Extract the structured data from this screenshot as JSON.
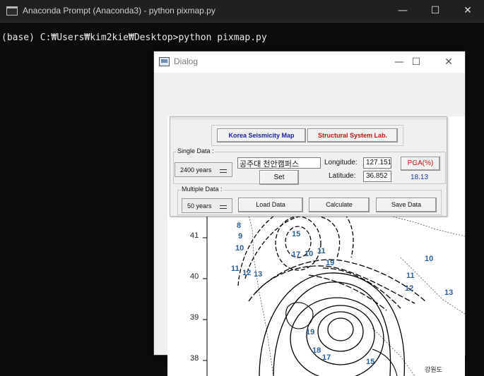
{
  "console": {
    "title": "Anaconda Prompt (Anaconda3) - python  pixmap.py",
    "command_line": "(base) C:₩Users₩kim2kie₩Desktop>python pixmap.py",
    "minimize_glyph": "—",
    "maximize_glyph": "☐",
    "close_glyph": "✕"
  },
  "dialog": {
    "title": "Dialog",
    "minimize_glyph": "—",
    "maximize_glyph": "☐",
    "close_glyph": "✕"
  },
  "panel": {
    "korea_map_button": "Korea Seismicity Map",
    "structural_lab_button": "Structural System Lab.",
    "single_data_label": "Single Data :",
    "years_select_value": "2400 years",
    "site_name_value": "공주대 천안캠퍼스",
    "set_button": "Set",
    "longitude_label": "Longitude:",
    "longitude_value": "127.151",
    "latitude_label": "Latitude:",
    "latitude_value": "36.852",
    "pga_button": "PGA(%)",
    "pga_value": "18.13",
    "multiple_data_label": "Multiple Data :",
    "multi_years_select_value": "50 years",
    "load_data_button": "Load Data",
    "calculate_button": "Calculate",
    "save_data_button": "Save Data",
    "korea_map_color": "#1a1aa8",
    "structural_lab_color": "#d01010",
    "pga_color": "#d01010",
    "pga_value_color": "#1a3aa8"
  },
  "map": {
    "lat_labels": [
      "41",
      "40",
      "39",
      "38"
    ],
    "contour_numbers": [
      "8",
      "9",
      "10",
      "11",
      "12",
      "13",
      "15",
      "10",
      "11",
      "17",
      "19",
      "11",
      "12",
      "10",
      "13",
      "19",
      "18",
      "17",
      "15"
    ],
    "place_label": "강원도"
  }
}
